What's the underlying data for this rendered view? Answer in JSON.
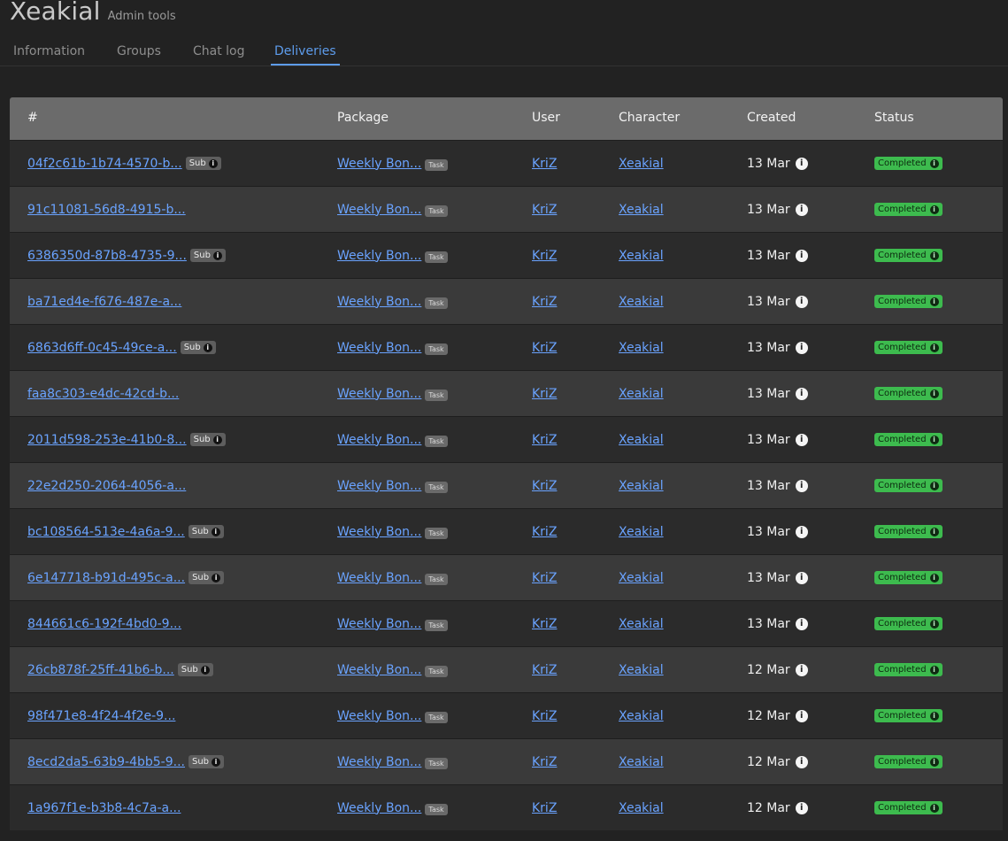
{
  "app": {
    "title": "Xeakial",
    "subtitle": "Admin tools"
  },
  "tabs": [
    {
      "label": "Information",
      "active": false
    },
    {
      "label": "Groups",
      "active": false
    },
    {
      "label": "Chat log",
      "active": false
    },
    {
      "label": "Deliveries",
      "active": true
    }
  ],
  "table": {
    "columns": [
      "#",
      "Package",
      "User",
      "Character",
      "Created",
      "Status"
    ],
    "badges": {
      "sub": "Sub",
      "task": "Task",
      "info_glyph": "i"
    },
    "rows": [
      {
        "id": "04f2c61b-1b74-4570-b...",
        "sub": true,
        "package": "Weekly Bon...",
        "user": "KriZ",
        "character": "Xeakial",
        "created": "13 Mar",
        "status": "Completed"
      },
      {
        "id": "91c11081-56d8-4915-b...",
        "sub": false,
        "package": "Weekly Bon...",
        "user": "KriZ",
        "character": "Xeakial",
        "created": "13 Mar",
        "status": "Completed"
      },
      {
        "id": "6386350d-87b8-4735-9...",
        "sub": true,
        "package": "Weekly Bon...",
        "user": "KriZ",
        "character": "Xeakial",
        "created": "13 Mar",
        "status": "Completed"
      },
      {
        "id": "ba71ed4e-f676-487e-a...",
        "sub": false,
        "package": "Weekly Bon...",
        "user": "KriZ",
        "character": "Xeakial",
        "created": "13 Mar",
        "status": "Completed"
      },
      {
        "id": "6863d6ff-0c45-49ce-a...",
        "sub": true,
        "package": "Weekly Bon...",
        "user": "KriZ",
        "character": "Xeakial",
        "created": "13 Mar",
        "status": "Completed"
      },
      {
        "id": "faa8c303-e4dc-42cd-b...",
        "sub": false,
        "package": "Weekly Bon...",
        "user": "KriZ",
        "character": "Xeakial",
        "created": "13 Mar",
        "status": "Completed"
      },
      {
        "id": "2011d598-253e-41b0-8...",
        "sub": true,
        "package": "Weekly Bon...",
        "user": "KriZ",
        "character": "Xeakial",
        "created": "13 Mar",
        "status": "Completed"
      },
      {
        "id": "22e2d250-2064-4056-a...",
        "sub": false,
        "package": "Weekly Bon...",
        "user": "KriZ",
        "character": "Xeakial",
        "created": "13 Mar",
        "status": "Completed"
      },
      {
        "id": "bc108564-513e-4a6a-9...",
        "sub": true,
        "package": "Weekly Bon...",
        "user": "KriZ",
        "character": "Xeakial",
        "created": "13 Mar",
        "status": "Completed"
      },
      {
        "id": "6e147718-b91d-495c-a...",
        "sub": true,
        "package": "Weekly Bon...",
        "user": "KriZ",
        "character": "Xeakial",
        "created": "13 Mar",
        "status": "Completed"
      },
      {
        "id": "844661c6-192f-4bd0-9...",
        "sub": false,
        "package": "Weekly Bon...",
        "user": "KriZ",
        "character": "Xeakial",
        "created": "13 Mar",
        "status": "Completed"
      },
      {
        "id": "26cb878f-25ff-41b6-b...",
        "sub": true,
        "package": "Weekly Bon...",
        "user": "KriZ",
        "character": "Xeakial",
        "created": "12 Mar",
        "status": "Completed"
      },
      {
        "id": "98f471e8-4f24-4f2e-9...",
        "sub": false,
        "package": "Weekly Bon...",
        "user": "KriZ",
        "character": "Xeakial",
        "created": "12 Mar",
        "status": "Completed"
      },
      {
        "id": "8ecd2da5-63b9-4bb5-9...",
        "sub": true,
        "package": "Weekly Bon...",
        "user": "KriZ",
        "character": "Xeakial",
        "created": "12 Mar",
        "status": "Completed"
      },
      {
        "id": "1a967f1e-b3b8-4c7a-a...",
        "sub": false,
        "package": "Weekly Bon...",
        "user": "KriZ",
        "character": "Xeakial",
        "created": "12 Mar",
        "status": "Completed"
      }
    ]
  },
  "colors": {
    "accent": "#5d9cec",
    "link": "#6aa3ff",
    "status_completed": "#3dbb4e",
    "header_bg": "#6b6b6b"
  }
}
